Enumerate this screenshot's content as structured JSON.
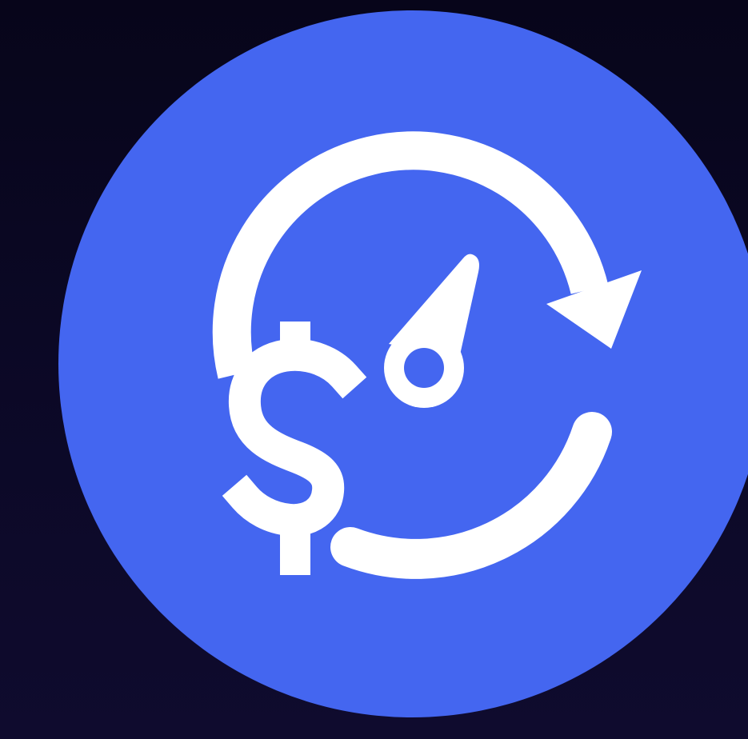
{
  "logo": {
    "name": "cost-speed-refresh-logo",
    "icon_names": [
      "circular-refresh-arrow-icon",
      "dollar-sign-icon",
      "gauge-needle-icon"
    ],
    "colors": {
      "background": "#0a0720",
      "circle": "#4466f0",
      "foreground": "#ffffff"
    }
  }
}
